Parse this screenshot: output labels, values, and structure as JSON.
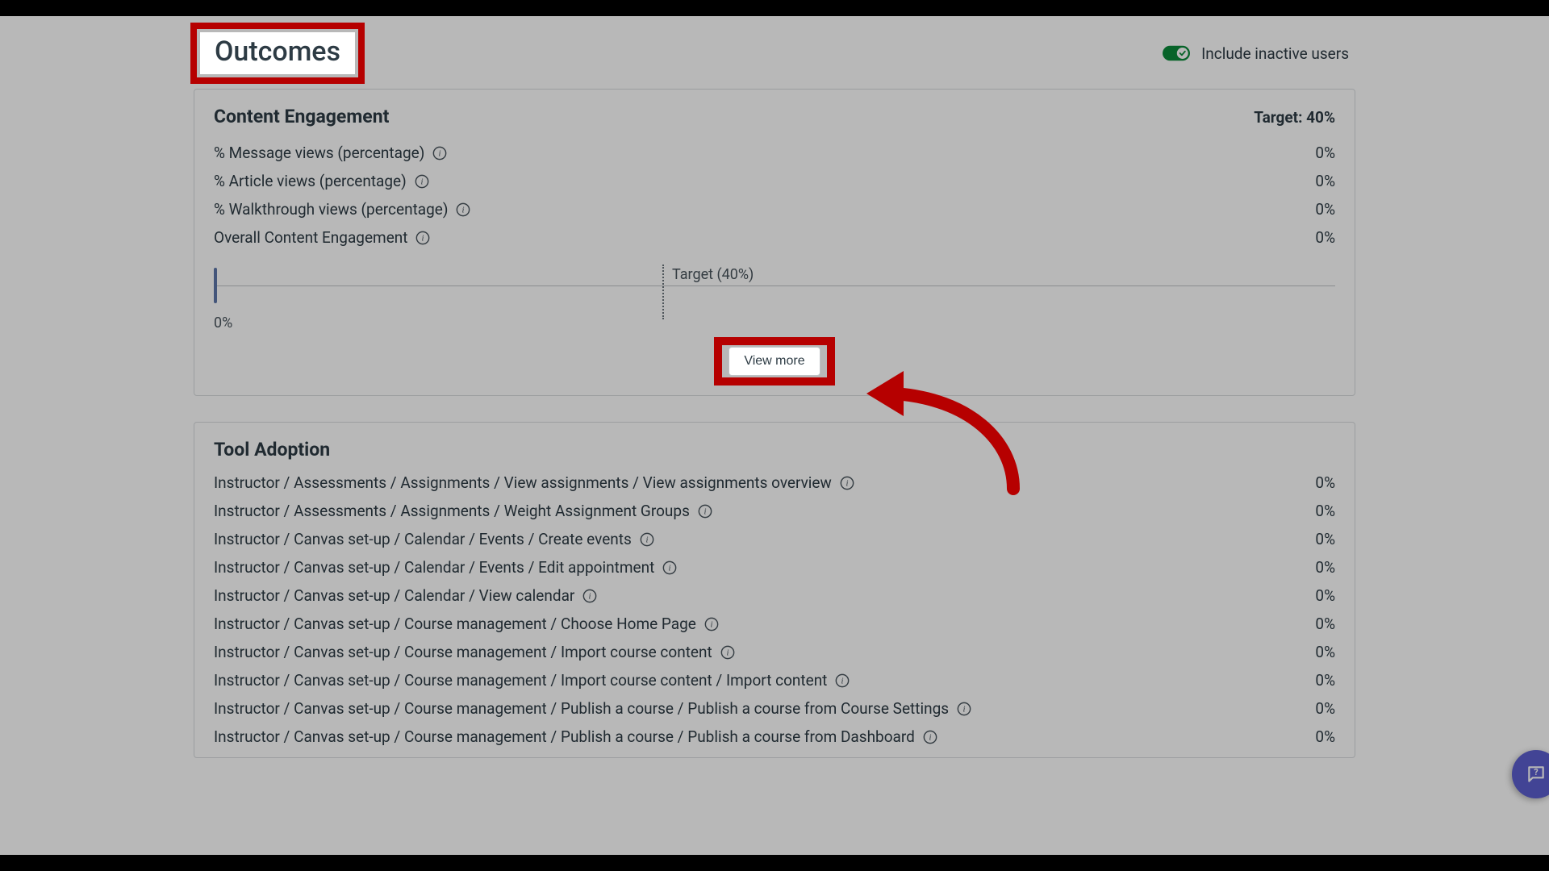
{
  "header": {
    "title": "Outcomes",
    "include_inactive_label": "Include inactive users"
  },
  "content_engagement": {
    "title": "Content Engagement",
    "target_label": "Target: 40%",
    "metrics": [
      {
        "label": "% Message views (percentage)",
        "value": "0%"
      },
      {
        "label": "% Article views (percentage)",
        "value": "0%"
      },
      {
        "label": "% Walkthrough views (percentage)",
        "value": "0%"
      },
      {
        "label": "Overall Content Engagement",
        "value": "0%"
      }
    ],
    "progress": {
      "target_label": "Target (40%)",
      "zero_label": "0%"
    },
    "view_more": "View more"
  },
  "tool_adoption": {
    "title": "Tool Adoption",
    "metrics": [
      {
        "label": "Instructor / Assessments / Assignments / View assignments / View assignments overview",
        "value": "0%"
      },
      {
        "label": "Instructor / Assessments / Assignments / Weight Assignment Groups",
        "value": "0%"
      },
      {
        "label": "Instructor / Canvas set-up / Calendar / Events / Create events",
        "value": "0%"
      },
      {
        "label": "Instructor / Canvas set-up / Calendar / Events / Edit appointment",
        "value": "0%"
      },
      {
        "label": "Instructor / Canvas set-up / Calendar / View calendar",
        "value": "0%"
      },
      {
        "label": "Instructor / Canvas set-up / Course management / Choose Home Page",
        "value": "0%"
      },
      {
        "label": "Instructor / Canvas set-up / Course management / Import course content",
        "value": "0%"
      },
      {
        "label": "Instructor / Canvas set-up / Course management / Import course content / Import content",
        "value": "0%"
      },
      {
        "label": "Instructor / Canvas set-up / Course management / Publish a course / Publish a course from Course Settings",
        "value": "0%"
      },
      {
        "label": "Instructor / Canvas set-up / Course management / Publish a course / Publish a course from Dashboard",
        "value": "0%"
      }
    ]
  }
}
